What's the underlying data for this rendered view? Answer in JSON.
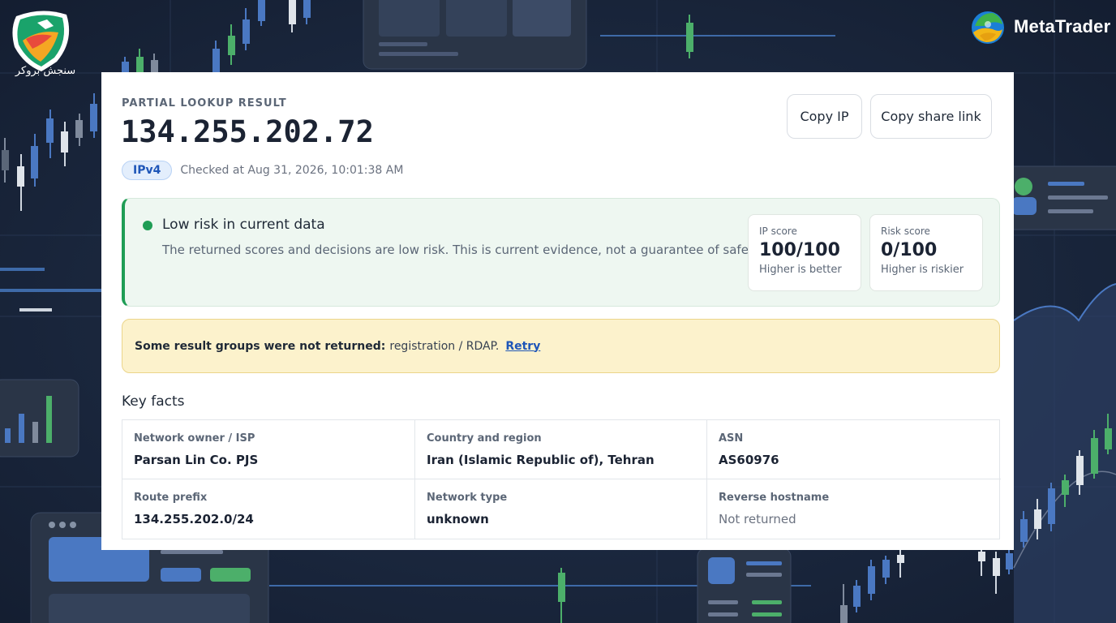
{
  "brand": {
    "left_logo_text": "سنجش بروکر",
    "right_logo_text": "MetaTrader"
  },
  "header": {
    "eyebrow": "PARTIAL LOOKUP RESULT",
    "ip": "134.255.202.72",
    "ip_version": "IPv4",
    "checked_at": "Checked at Aug 31, 2026, 10:01:38 AM"
  },
  "actions": {
    "copy_ip": "Copy IP",
    "copy_share_link": "Copy share link"
  },
  "risk": {
    "title": "Low risk in current data",
    "description": "The returned scores and decisions are low risk. This is current evidence, not a guarantee of safety.",
    "ip_score": {
      "label": "IP score",
      "value": "100/100",
      "hint": "Higher is better"
    },
    "risk_score": {
      "label": "Risk score",
      "value": "0/100",
      "hint": "Higher is riskier"
    }
  },
  "warning": {
    "strong": "Some result groups were not returned:",
    "text": "registration / RDAP.",
    "retry": "Retry"
  },
  "facts": {
    "title": "Key facts",
    "items": [
      {
        "label": "Network owner / ISP",
        "value": "Parsan Lin Co. PJS"
      },
      {
        "label": "Country and region",
        "value": "Iran (Islamic Republic of), Tehran"
      },
      {
        "label": "ASN",
        "value": "AS60976"
      },
      {
        "label": "Route prefix",
        "value": "134.255.202.0/24"
      },
      {
        "label": "Network type",
        "value": "unknown"
      },
      {
        "label": "Reverse hostname",
        "value": "Not returned"
      }
    ]
  },
  "colors": {
    "accent_blue": "#1e56b8",
    "risk_green": "#1f9d55",
    "warning_bg": "#fcf2cc",
    "background_navy": "#18243a"
  }
}
